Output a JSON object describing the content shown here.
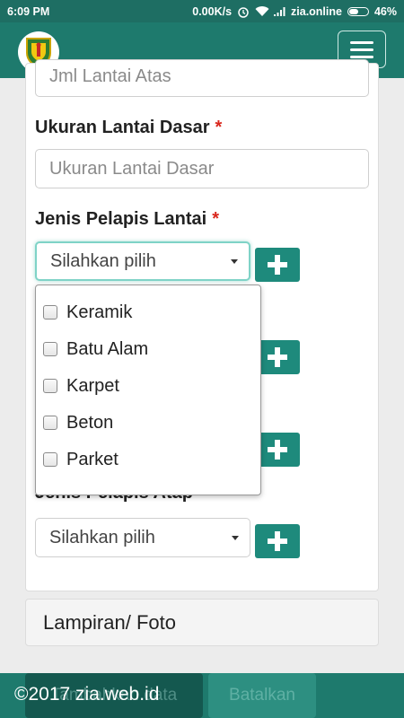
{
  "status_bar": {
    "time": "6:09 PM",
    "speed": "0.00K/s",
    "carrier": "zia.online",
    "battery": "46%",
    "icons": [
      "alarm-icon",
      "wifi-icon",
      "signal-icon",
      "battery-icon"
    ]
  },
  "navbar": {
    "logo": "government-emblem-logo",
    "menu_icon": "hamburger-icon"
  },
  "form": {
    "prev_field_placeholder": "Jml Lantai Atas",
    "floor_size": {
      "label": "Ukuran Lantai Dasar",
      "required": "*",
      "placeholder": "Ukuran Lantai Dasar"
    },
    "floor_cover": {
      "label": "Jenis Pelapis Lantai",
      "required": "*",
      "value": "Silahkan pilih"
    },
    "roof_cover": {
      "label": "Jenis Pelapis Atap",
      "required": "*",
      "value": "Silahkan pilih"
    },
    "dropdown_options": [
      "Keramik",
      "Batu Alam",
      "Karpet",
      "Beton",
      "Parket"
    ]
  },
  "attachment_section": {
    "title": "Lampiran/ Foto"
  },
  "footer": {
    "submit_label": "Tambahkan data",
    "cancel_label": "Batalkan",
    "copyright": "©2017 zia.web.id"
  },
  "colors": {
    "primary": "#1e7a6d",
    "button": "#1e8a7c",
    "required": "#d9261c"
  }
}
